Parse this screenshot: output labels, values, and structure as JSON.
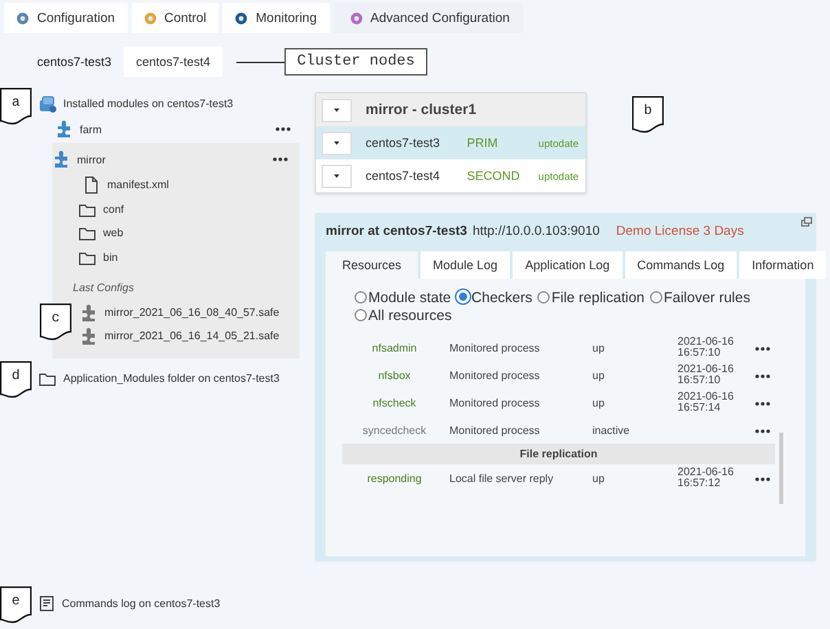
{
  "main_tabs": [
    {
      "label": "Configuration",
      "color": "#5b84ad",
      "selected": false
    },
    {
      "label": "Control",
      "color": "#e0a63a",
      "selected": false
    },
    {
      "label": "Monitoring",
      "color": "#1f5a94",
      "selected": false
    },
    {
      "label": "Advanced Configuration",
      "color": "#b36bc4",
      "selected": true
    }
  ],
  "nodes": [
    {
      "label": "centos7-test3",
      "selected": true
    },
    {
      "label": "centos7-test4",
      "selected": false
    }
  ],
  "cluster_nodes_note": "Cluster nodes",
  "installed_modules": {
    "label": "Installed modules on centos7-test3",
    "modules": [
      {
        "name": "farm",
        "expanded": false
      },
      {
        "name": "mirror",
        "expanded": true,
        "files": [
          {
            "kind": "file",
            "name": "manifest.xml"
          },
          {
            "kind": "folder",
            "name": "conf"
          },
          {
            "kind": "folder",
            "name": "web"
          },
          {
            "kind": "folder",
            "name": "bin"
          }
        ],
        "last_configs_label": "Last Configs",
        "configs": [
          "mirror_2021_06_16_08_40_57.safe",
          "mirror_2021_06_16_14_05_21.safe"
        ]
      }
    ]
  },
  "folder_link": "Application_Modules folder on centos7-test3",
  "commands_log": "Commands log on centos7-test3",
  "cluster": {
    "title": "mirror - cluster1",
    "nodes": [
      {
        "name": "centos7-test3",
        "role": "PRIM",
        "status": "uptodate",
        "selected": true
      },
      {
        "name": "centos7-test4",
        "role": "SECOND",
        "status": "uptodate",
        "selected": false
      }
    ]
  },
  "detail": {
    "module": "mirror at centos7-test3",
    "url": "http://10.0.0.103:9010",
    "license": "Demo License 3 Days",
    "tabs": [
      {
        "label": "Resources",
        "selected": true
      },
      {
        "label": "Module Log",
        "selected": false
      },
      {
        "label": "Application Log",
        "selected": false
      },
      {
        "label": "Commands Log",
        "selected": false
      },
      {
        "label": "Information",
        "selected": false
      }
    ],
    "filters": [
      {
        "label": "Module state",
        "selected": false
      },
      {
        "label": "Checkers",
        "selected": true
      },
      {
        "label": "File replication",
        "selected": false
      },
      {
        "label": "Failover rules",
        "selected": false
      },
      {
        "label": "All resources",
        "selected": false
      }
    ],
    "rows": [
      {
        "kind": "resource",
        "name": "nfsadmin",
        "type": "Monitored process",
        "state": "up",
        "time": "2021-06-16 16:57:10",
        "active": true
      },
      {
        "kind": "resource",
        "name": "nfsbox",
        "type": "Monitored process",
        "state": "up",
        "time": "2021-06-16 16:57:10",
        "active": true
      },
      {
        "kind": "resource",
        "name": "nfscheck",
        "type": "Monitored process",
        "state": "up",
        "time": "2021-06-16 16:57:14",
        "active": true
      },
      {
        "kind": "resource",
        "name": "syncedcheck",
        "type": "Monitored process",
        "state": "inactive",
        "active": false
      },
      {
        "kind": "section",
        "label": "File replication"
      },
      {
        "kind": "resource",
        "name": "responding",
        "type": "Local file server reply",
        "state": "up",
        "time": "2021-06-16 16:57:12",
        "active": true
      }
    ]
  },
  "callouts": [
    {
      "label": "a"
    },
    {
      "label": "b"
    },
    {
      "label": "c"
    },
    {
      "label": "d"
    },
    {
      "label": "e"
    }
  ]
}
